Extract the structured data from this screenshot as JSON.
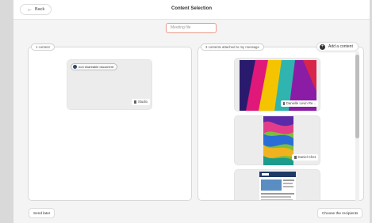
{
  "header": {
    "back_label": "Back",
    "title": "Content Selection"
  },
  "search": {
    "value": "Meeting file"
  },
  "left_panel": {
    "count_label": "1 content",
    "items": [
      {
        "doc_label": "non shareable document",
        "owner": "Studio"
      }
    ]
  },
  "right_panel": {
    "count_label": "3 contents attached to my message",
    "add_label": "Add a content",
    "items": [
      {
        "owner": "Danielle Levin Re..."
      },
      {
        "owner": "Daniel Chet"
      },
      {
        "owner": ""
      }
    ]
  },
  "footer": {
    "send_later_label": "Send later",
    "choose_recipients_label": "Choose the recipients"
  },
  "colors": {
    "search_border": "#e99a8a",
    "accent_dark": "#2f4a6b"
  }
}
